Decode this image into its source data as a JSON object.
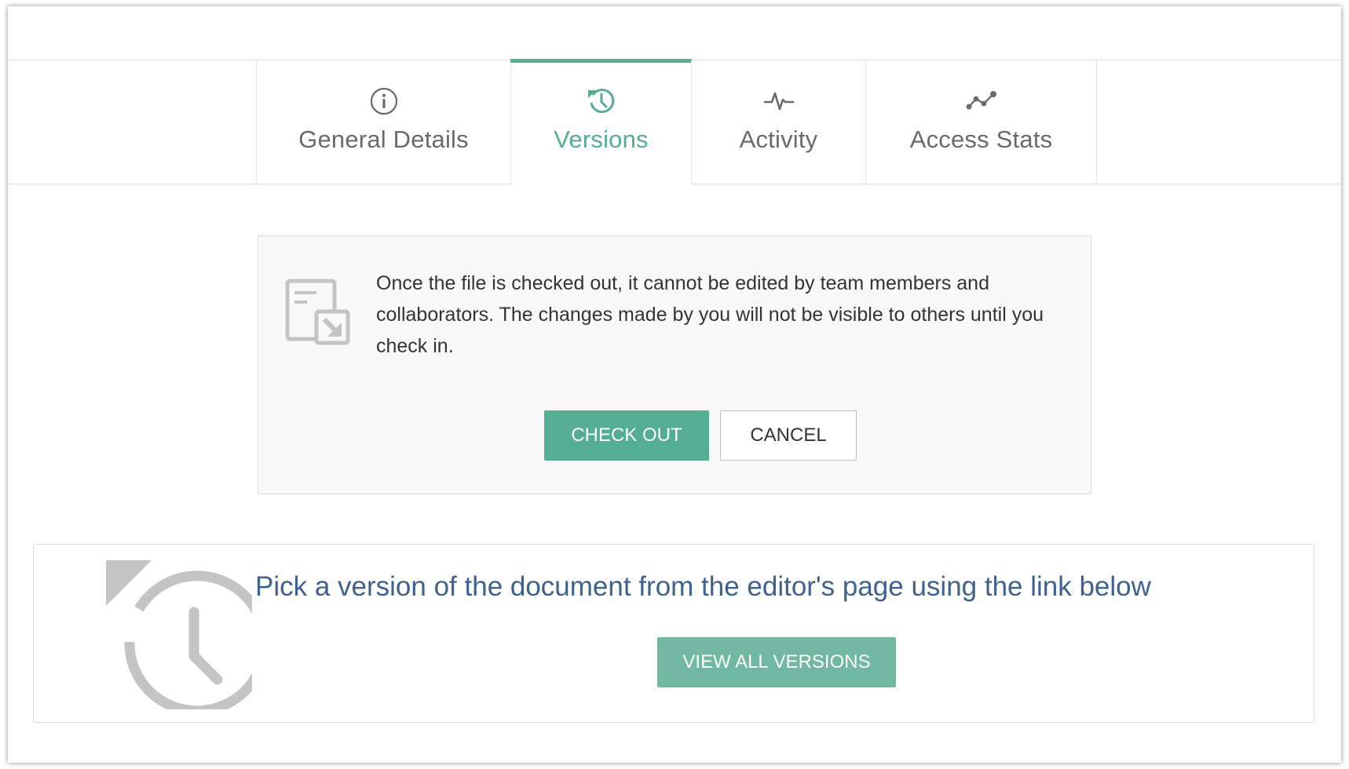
{
  "tabs": [
    {
      "label": "General Details",
      "icon": "info-icon",
      "active": false
    },
    {
      "label": "Versions",
      "icon": "history-icon",
      "active": true
    },
    {
      "label": "Activity",
      "icon": "pulse-icon",
      "active": false
    },
    {
      "label": "Access Stats",
      "icon": "line-chart-icon",
      "active": false
    }
  ],
  "checkout": {
    "icon": "file-checkout-icon",
    "message": "Once the file is checked out, it cannot be edited by team members and collaborators. The changes made by you will not be visible to others until you check in.",
    "checkout_label": "CHECK OUT",
    "cancel_label": "CANCEL"
  },
  "versions": {
    "icon": "history-icon",
    "heading": "Pick a version of the document from the editor's page using the link below",
    "view_all_label": "VIEW ALL VERSIONS"
  },
  "colors": {
    "accent": "#55ad93",
    "accent_light": "#70b8a2",
    "heading_blue": "#3f6190",
    "tab_text": "#6a6a6a",
    "icon_gray": "#c4c4c4"
  }
}
